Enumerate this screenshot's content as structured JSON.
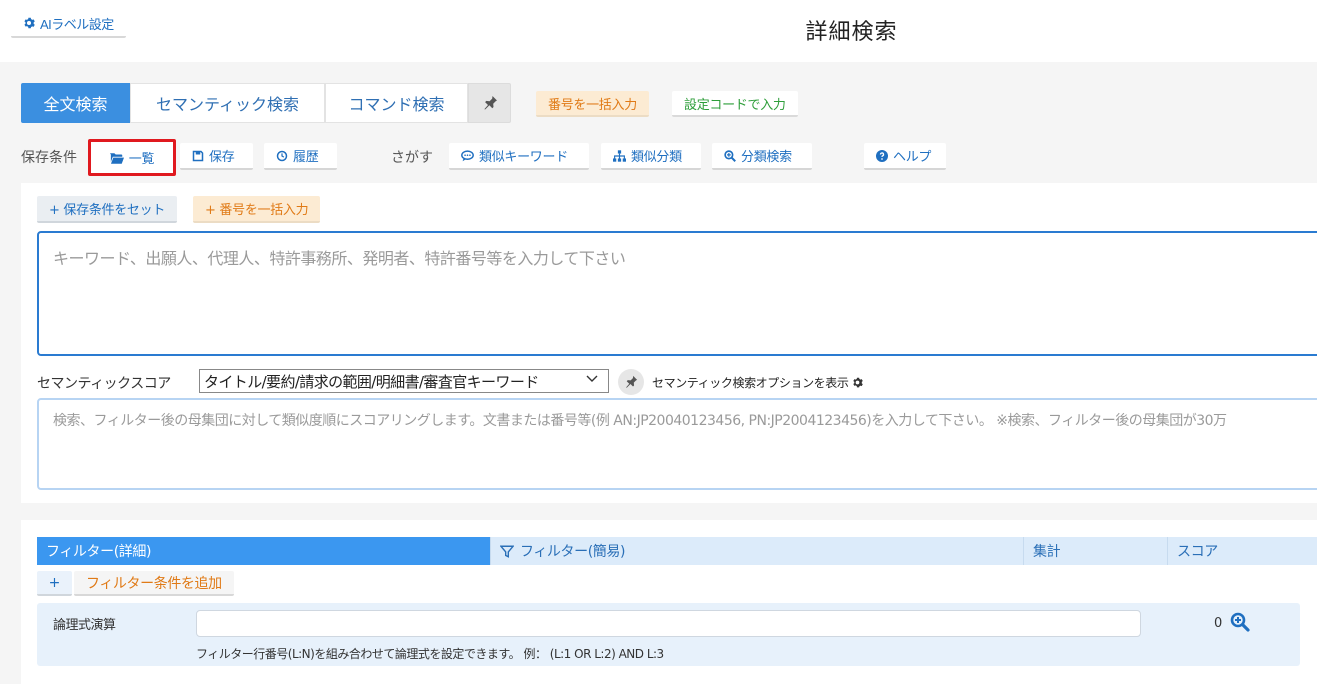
{
  "header": {
    "ai_label_button": "AIラベル設定",
    "title": "詳細検索"
  },
  "tabs": [
    {
      "label": "全文検索",
      "active": true
    },
    {
      "label": "セマンティック検索",
      "active": false
    },
    {
      "label": "コマンド検索",
      "active": false
    }
  ],
  "top_actions": {
    "bulk_number": "番号を一括入力",
    "code_input": "設定コードで入力"
  },
  "saved": {
    "label": "保存条件",
    "list": "一覧",
    "save": "保存",
    "history": "履歴"
  },
  "search_tools": {
    "label": "さがす",
    "similar_keyword": "類似キーワード",
    "similar_class": "類似分類",
    "class_search": "分類検索",
    "help": "ヘルプ"
  },
  "search_card": {
    "set_saved": "+ 保存条件をセット",
    "bulk_number": "+ 番号を一括入力",
    "keyword_placeholder": "キーワード、出願人、代理人、特許事務所、発明者、特許番号等を入力して下さい",
    "semantic_label": "セマンティックスコア",
    "semantic_select_value": "タイトル/要約/請求の範囲/明細書/審査官キーワード",
    "semantic_options_link": "セマンティック検索オプションを表示",
    "semantic_placeholder": "検索、フィルター後の母集団に対して類似度順にスコアリングします。文書または番号等(例 AN:JP20040123456, PN:JP2004123456)を入力して下さい。 ※検索、フィルター後の母集団が30万"
  },
  "filter": {
    "tabs": {
      "detail": "フィルター(詳細)",
      "simple": "フィルター(簡易)",
      "aggregate": "集計",
      "score": "スコア"
    },
    "plus": "+",
    "add_condition": "フィルター条件を追加",
    "logic_label": "論理式演算",
    "logic_value": "",
    "logic_hint": "フィルター行番号(L:N)を組み合わせて論理式を設定できます。   例： (L:1 OR L:2) AND L:3",
    "count": "0"
  },
  "colors": {
    "accent": "#3b8fe0",
    "link": "#1f6fc0",
    "orange": "#e07a16",
    "green": "#2e9e3a",
    "highlight_red": "#e0191f"
  },
  "icons": {
    "gear": "gear-icon",
    "pin": "pin-icon",
    "folder": "folder-open-icon",
    "save": "floppy-icon",
    "history": "history-icon",
    "comment": "comment-icon",
    "sitemap": "sitemap-icon",
    "search_plus": "search-plus-icon",
    "help": "question-circle-icon",
    "filter": "filter-icon",
    "zoom": "zoom-in-icon"
  }
}
